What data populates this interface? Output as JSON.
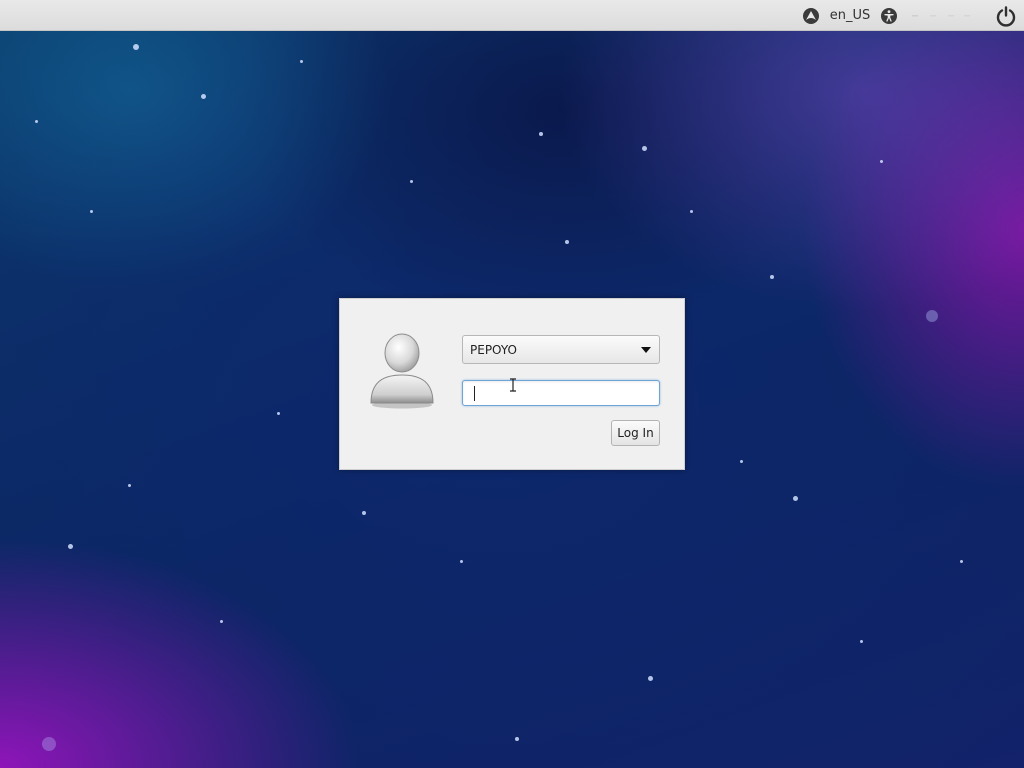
{
  "topbar": {
    "session_icon": "session-icon",
    "language": "en_US",
    "accessibility_icon": "accessibility-icon",
    "power_icon": "power-icon"
  },
  "login": {
    "avatar_icon": "user-avatar-icon",
    "user_select": {
      "selected": "PEPOYO"
    },
    "password": {
      "value": "",
      "placeholder": ""
    },
    "login_button": "Log In"
  },
  "colors": {
    "topbar_bg": "#dedede",
    "dialog_bg": "#f0f0f0",
    "focus_border": "#6ea4d6",
    "background_blue": "#0a2a5c",
    "background_purple": "#8c14aa"
  }
}
